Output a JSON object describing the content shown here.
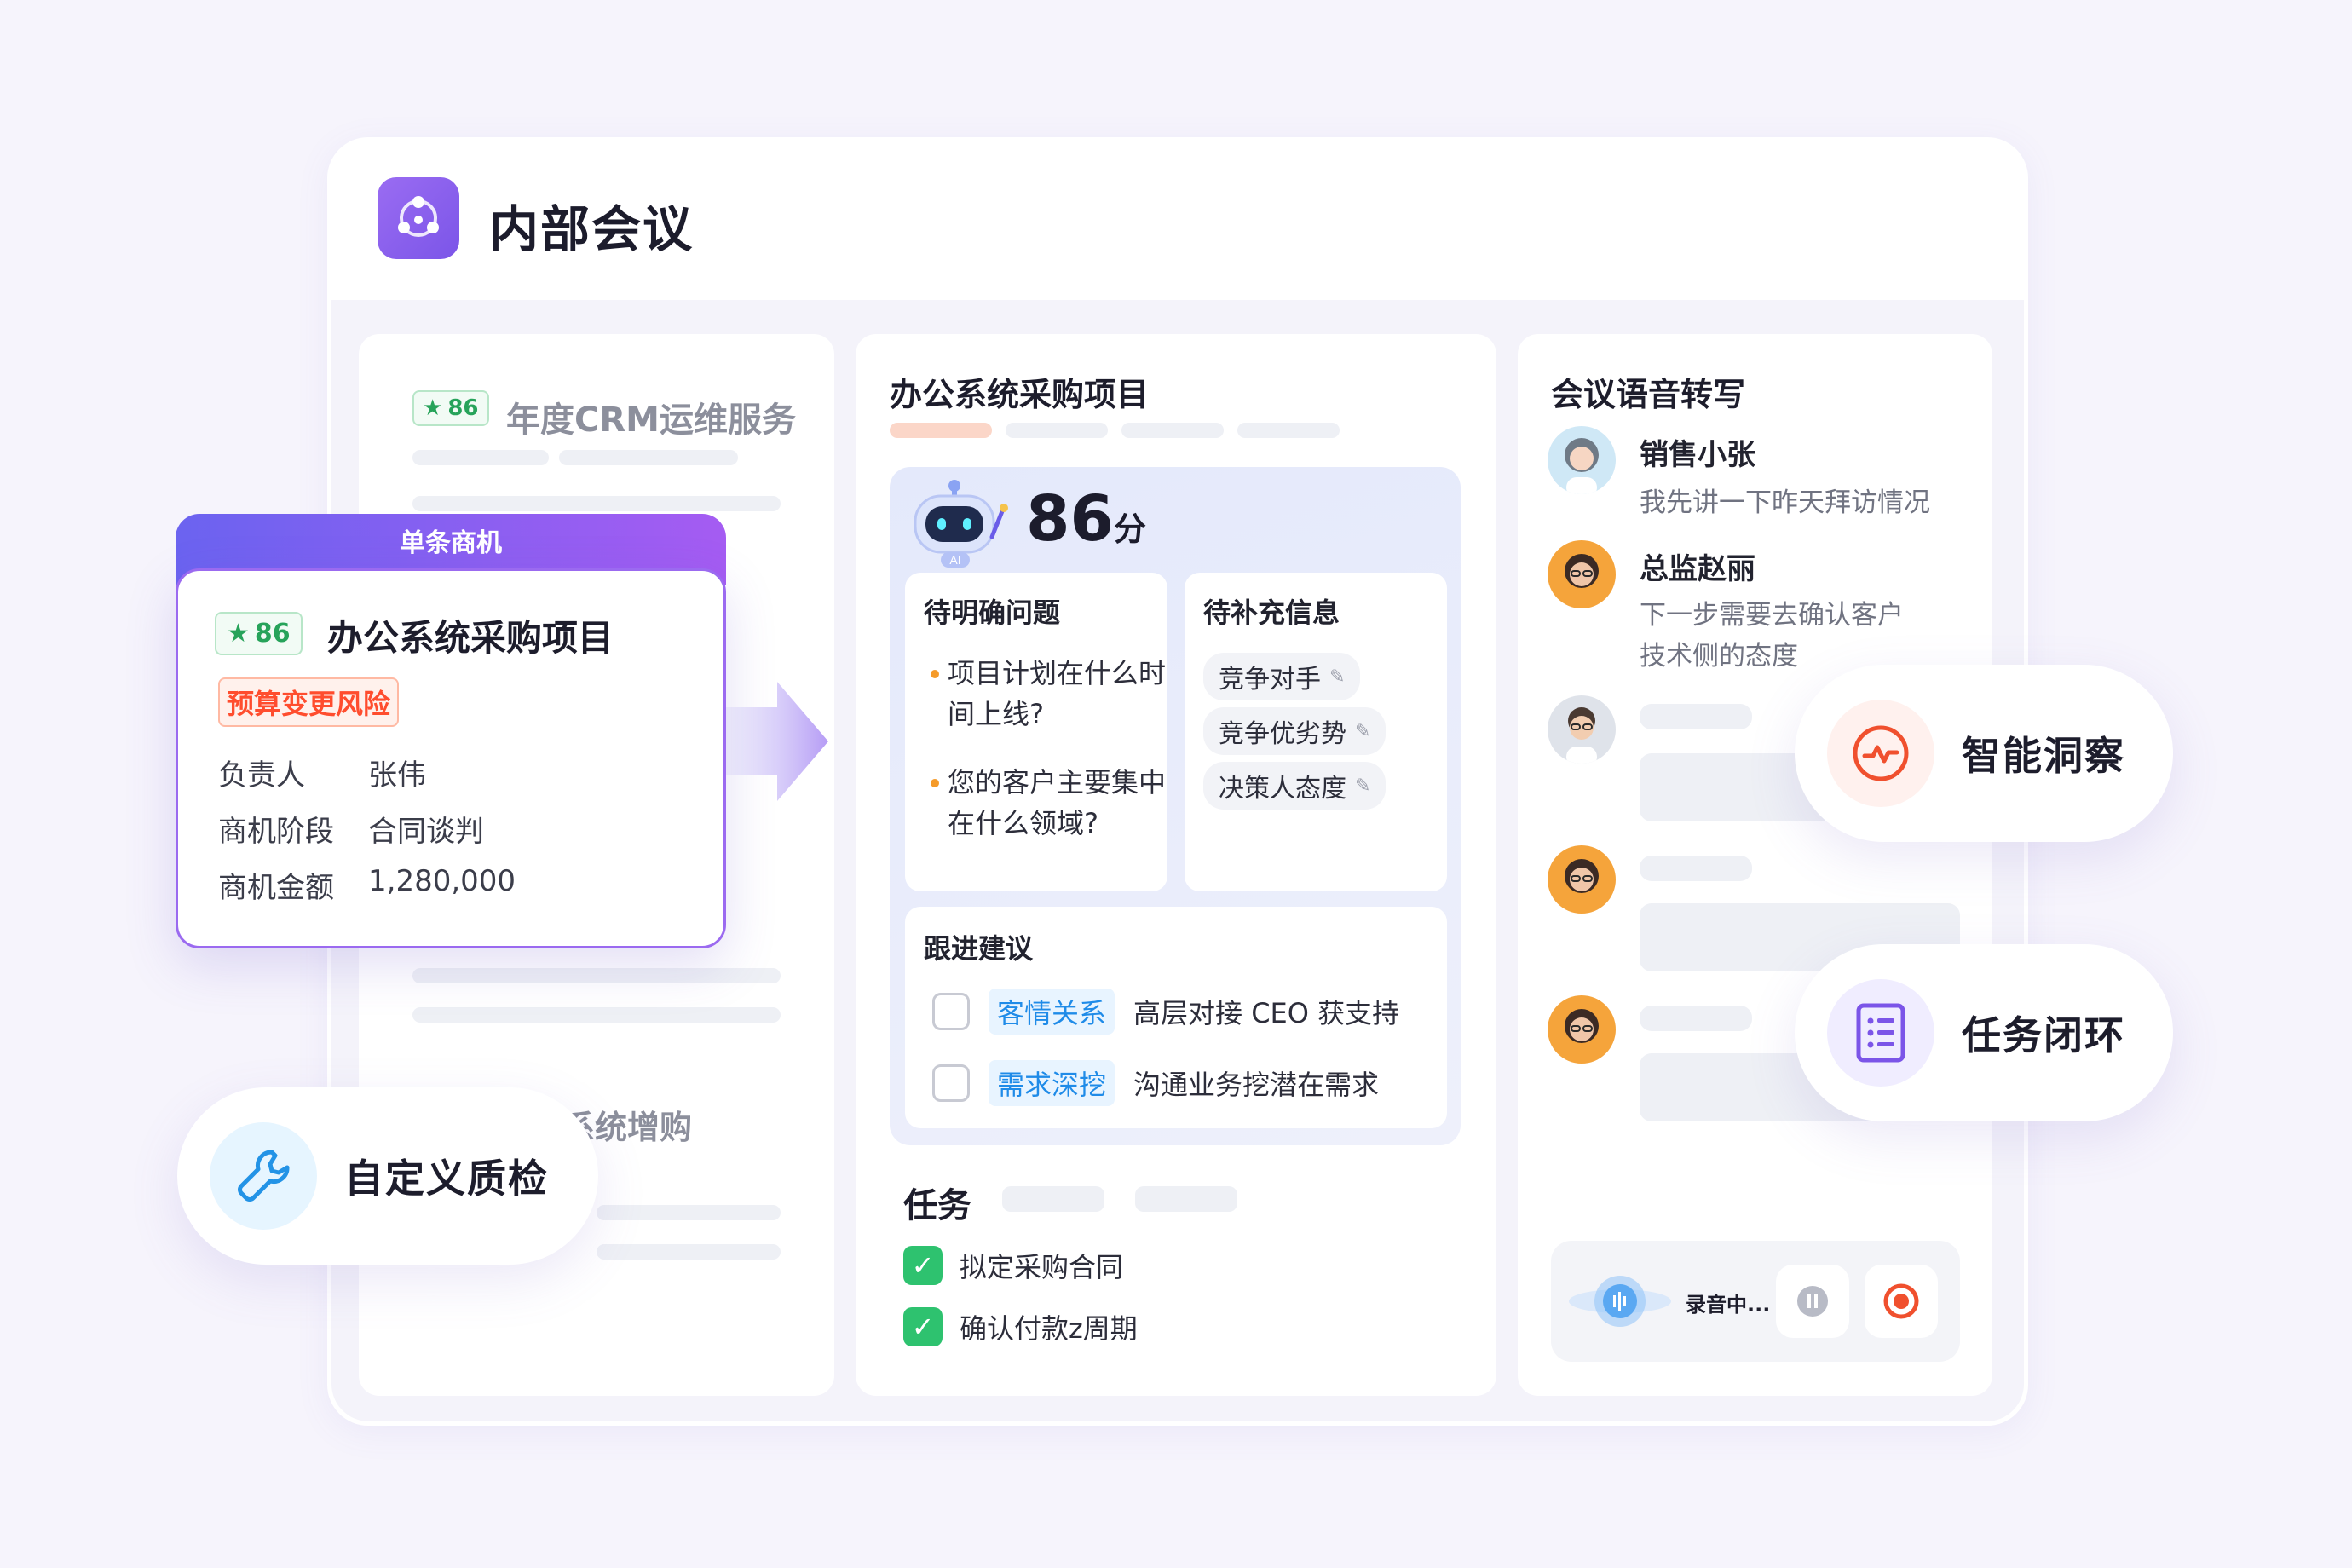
{
  "app": {
    "title": "内部会议"
  },
  "left_panel": {
    "opp1": {
      "score": "86",
      "title": "年度CRM运维服务"
    },
    "opp2": {
      "title": "系统增购"
    }
  },
  "opportunity_card": {
    "header": "单条商机",
    "score": "86",
    "title": "办公系统采购项目",
    "risk_tag": "预算变更风险",
    "fields": [
      {
        "label": "负责人",
        "value": "张伟"
      },
      {
        "label": "商机阶段",
        "value": "合同谈判"
      },
      {
        "label": "商机金额",
        "value": "1,280,000"
      }
    ]
  },
  "middle_panel": {
    "title": "办公系统采购项目",
    "ai_score": {
      "value": "86",
      "unit": "分",
      "badge": "AI"
    },
    "questions": {
      "title": "待明确问题",
      "items": [
        "项目计划在什么时间上线?",
        "您的客户主要集中在什么领域?"
      ]
    },
    "pending_info": {
      "title": "待补充信息",
      "chips": [
        "竞争对手",
        "竞争优劣势",
        "决策人态度"
      ]
    },
    "suggestions": {
      "title": "跟进建议",
      "items": [
        {
          "tag": "客情关系",
          "text": "高层对接 CEO 获支持"
        },
        {
          "tag": "需求深挖",
          "text": "沟通业务挖潜在需求"
        }
      ]
    },
    "tasks": {
      "title": "任务",
      "items": [
        "拟定采购合同",
        "确认付款z周期"
      ]
    }
  },
  "right_panel": {
    "title": "会议语音转写",
    "messages": [
      {
        "speaker": "销售小张",
        "text": "我先讲一下昨天拜访情况"
      },
      {
        "speaker": "总监赵丽",
        "lines": [
          "下一步需要去确认客户",
          "技术侧的态度"
        ]
      }
    ],
    "recording": {
      "label": "录音中..."
    }
  },
  "features": {
    "insight": "智能洞察",
    "task_loop": "任务闭环",
    "custom_qc": "自定义质检"
  },
  "colors": {
    "brand": "#7b55e8",
    "success": "#2ec26f",
    "risk": "#ff4d2e",
    "tag_blue": "#1f8be8",
    "record_red": "#f0502e"
  }
}
